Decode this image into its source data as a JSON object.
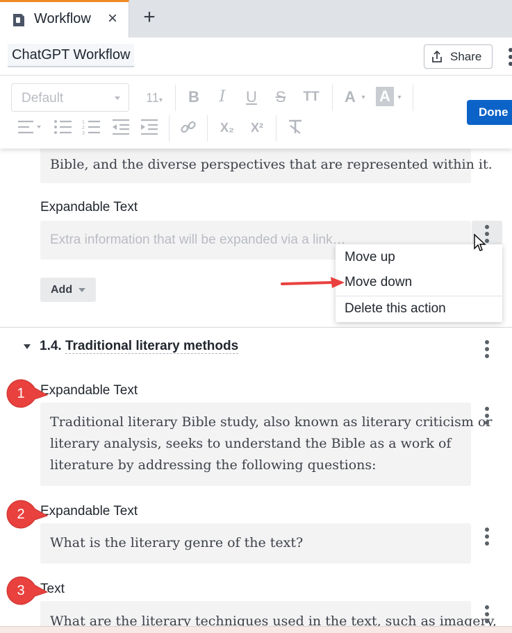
{
  "tab": {
    "title": "Workflow",
    "close_glyph": "×",
    "new_tab_glyph": "+"
  },
  "header": {
    "doc_title": "ChatGPT Workflow",
    "share_label": "Share"
  },
  "toolbar": {
    "font_select": "Default",
    "font_size": "11",
    "done_label": "Done",
    "buttons": [
      "bold",
      "italic",
      "underline",
      "strikethrough",
      "text-size",
      "font-color",
      "highlight-color",
      "align",
      "bullet-list",
      "numbered-list",
      "outdent",
      "indent",
      "link",
      "subscript",
      "superscript",
      "clear-formatting"
    ],
    "labels": {
      "bold": "B",
      "italic": "I",
      "underline": "U",
      "strike": "S",
      "text_size": "TT",
      "font_color": "A",
      "highlight": "A",
      "subscript": "X₂",
      "superscript": "X²"
    }
  },
  "content": {
    "top_box_line1": "Bible, and the diverse perspectives that are represented within it.",
    "expandable_label_1": "Expandable Text",
    "expandable_placeholder": "Extra information that will be expanded via a link…",
    "add_label": "Add",
    "section": {
      "number": "1.4.",
      "title": "Traditional literary methods"
    },
    "items": [
      {
        "label": "Expandable Text",
        "text_lines": [
          "Traditional literary Bible study, also known as literary criticism or",
          "literary analysis, seeks to understand the Bible as a work of",
          "literature by addressing the following questions:"
        ]
      },
      {
        "label": "Expandable Text",
        "text_lines": [
          "What is the literary genre of the text?"
        ]
      },
      {
        "label": "Text",
        "text_lines": [
          "What are the literary techniques used in the text, such as imagery,"
        ]
      }
    ]
  },
  "menu": {
    "items": [
      "Move up",
      "Move down",
      "Delete this action"
    ]
  },
  "annotations": {
    "badges": [
      "1",
      "2",
      "3"
    ],
    "badge_color": "#e8413e"
  },
  "colors": {
    "accent": "#0b63c8",
    "tab_accent": "#f08a24",
    "annotation": "#e8413e"
  }
}
